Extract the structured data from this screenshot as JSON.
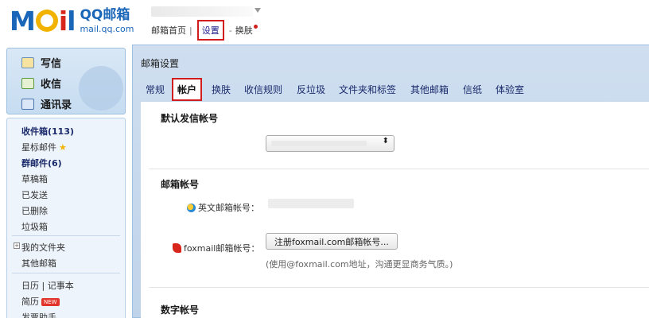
{
  "header": {
    "logo_letters": [
      "M",
      "",
      "i",
      "l"
    ],
    "logo_title": "QQ邮箱",
    "logo_domain": "mail.qq.com",
    "nav": {
      "home": "邮箱首页",
      "separator": "|",
      "settings": "设置",
      "dash": "-",
      "skin": "换肤"
    }
  },
  "sidebar": {
    "actions": [
      {
        "label": "写信",
        "icon": "compose-icon"
      },
      {
        "label": "收信",
        "icon": "inbox-icon"
      },
      {
        "label": "通讯录",
        "icon": "contacts-icon"
      }
    ],
    "folders": {
      "inbox": "收件箱(113)",
      "starred": "星标邮件",
      "star_glyph": "★",
      "group": "群邮件(6)",
      "drafts": "草稿箱",
      "sent": "已发送",
      "deleted": "已删除",
      "spam": "垃圾箱",
      "plus_glyph": "+",
      "my_folders": "我的文件夹",
      "other_mail": "其他邮箱",
      "calendar_notes": "日历 | 记事本",
      "resume": "简历",
      "new_badge": "NEW",
      "assistant": "发票助手"
    }
  },
  "main": {
    "title": "邮箱设置",
    "tabs": [
      "常规",
      "帐户",
      "换肤",
      "收信规则",
      "反垃圾",
      "文件夹和标签",
      "其他邮箱",
      "信纸",
      "体验室"
    ],
    "active_tab": "帐户",
    "sections": {
      "default_sender": "默认发信帐号",
      "select_arrow": "⬍",
      "mail_accounts": "邮箱帐号",
      "english_account_label": "英文邮箱帐号：",
      "foxmail_label": "foxmail邮箱帐号：",
      "foxmail_button": "注册foxmail.com邮箱帐号...",
      "foxmail_hint": "(使用@foxmail.com地址，沟通更显商务气质。)",
      "digital_account": "数字帐号"
    }
  },
  "colors": {
    "brand_blue": "#1a66b8",
    "highlight_red": "#d21d1d",
    "panel_blue": "#cfdff0"
  }
}
